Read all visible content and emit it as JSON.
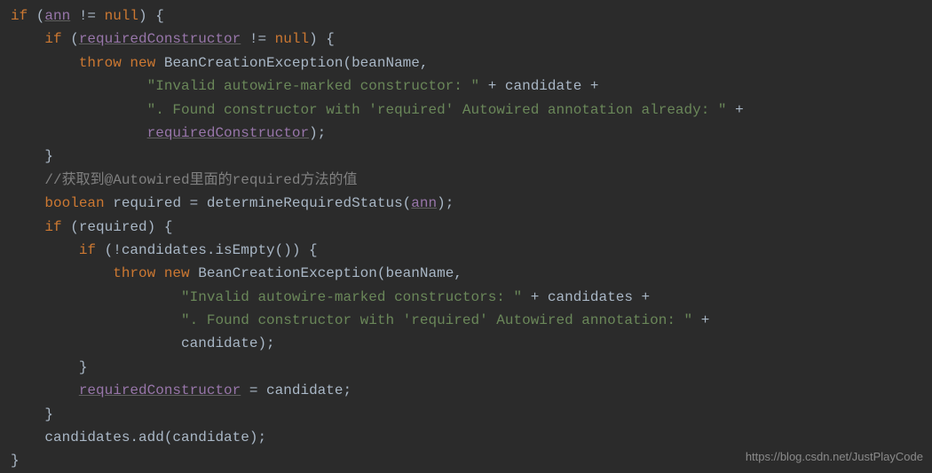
{
  "line1_if": "if",
  "line1_var": "ann",
  "line1_op": " != ",
  "line1_null": "null",
  "line1_brace": ") {",
  "line2_if": "if",
  "line2_var": "requiredConstructor",
  "line2_op": " != ",
  "line2_null": "null",
  "line2_brace": ") {",
  "line3_throw": "throw new",
  "line3_cls": " BeanCreationException(beanName,",
  "line4_str": "\"Invalid autowire-marked constructor: \"",
  "line4_op": " + candidate +",
  "line5_str": "\". Found constructor with 'required' Autowired annotation already: \"",
  "line5_op": " +",
  "line6_var": "requiredConstructor",
  "line6_close": ");",
  "line7_brace": "}",
  "line8_cmt": "//获取到@Autowired里面的required方法的值",
  "line9_kw": "boolean",
  "line9_pln": " required = determineRequiredStatus(",
  "line9_var": "ann",
  "line9_close": ");",
  "line10_if": "if",
  "line10_pln": " (required) {",
  "line11_if": "if",
  "line11_pln": " (!candidates.isEmpty()) {",
  "line12_throw": "throw new",
  "line12_cls": " BeanCreationException(beanName,",
  "line13_str": "\"Invalid autowire-marked constructors: \"",
  "line13_op": " + candidates +",
  "line14_str": "\". Found constructor with 'required' Autowired annotation: \"",
  "line14_op": " +",
  "line15_pln": "candidate);",
  "line16_brace": "}",
  "line17_var": "requiredConstructor",
  "line17_pln": " = candidate;",
  "line18_brace": "}",
  "line19_pln": "candidates.add(candidate);",
  "line20_brace": "}",
  "watermark": "https://blog.csdn.net/JustPlayCode"
}
